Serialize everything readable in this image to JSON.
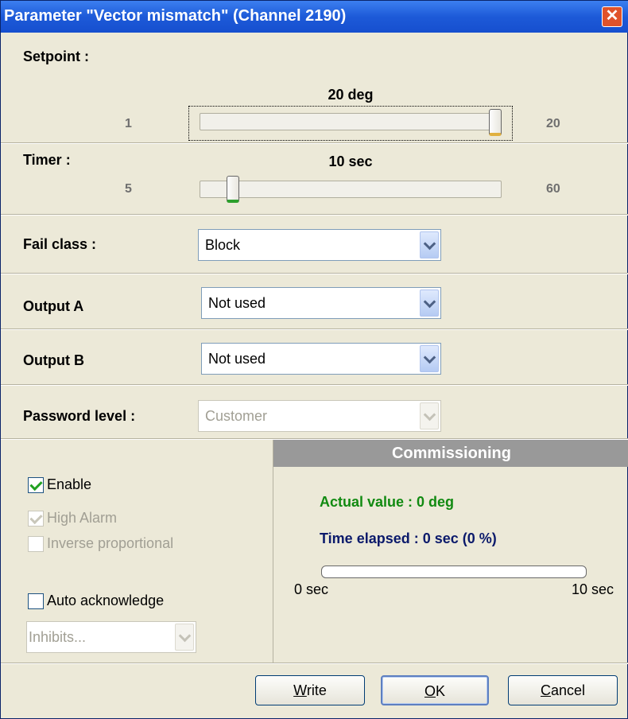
{
  "window": {
    "title": "Parameter \"Vector mismatch\" (Channel 2190)",
    "close_glyph": "✕"
  },
  "setpoint": {
    "label": "Setpoint :",
    "value_text": "20 deg",
    "min": "1",
    "max": "20",
    "value": 20
  },
  "timer": {
    "label": "Timer :",
    "value_text": "10 sec",
    "min": "5",
    "max": "60",
    "value": 10
  },
  "fail_class": {
    "label": "Fail class :",
    "value": "Block"
  },
  "output_a": {
    "label": "Output A",
    "value": "Not used"
  },
  "output_b": {
    "label": "Output B",
    "value": "Not used"
  },
  "password_level": {
    "label": "Password level :",
    "value": "Customer"
  },
  "options": {
    "enable": {
      "label": "Enable",
      "checked": true,
      "disabled": false
    },
    "high_alarm": {
      "label": "High Alarm",
      "checked": true,
      "disabled": true
    },
    "inverse_proportional": {
      "label": "Inverse proportional",
      "checked": false,
      "disabled": true
    },
    "auto_acknowledge": {
      "label": "Auto acknowledge",
      "checked": false,
      "disabled": false
    },
    "inhibits": {
      "value": "Inhibits..."
    }
  },
  "commissioning": {
    "header": "Commissioning",
    "actual_value": "Actual value : 0 deg",
    "time_elapsed": "Time elapsed : 0 sec (0 %)",
    "progress_fraction": 0,
    "progress_min_label": "0 sec",
    "progress_max_label": "10 sec"
  },
  "buttons": {
    "write": {
      "pre": "",
      "key": "W",
      "post": "rite"
    },
    "ok": {
      "pre": "",
      "key": "O",
      "post": "K"
    },
    "cancel": {
      "pre": "",
      "key": "C",
      "post": "ancel"
    }
  },
  "colors": {
    "title_bar": "#1d5ad8",
    "actual_value": "#118a11",
    "time_elapsed": "#0b1a6b",
    "commissioning_header": "#999999",
    "check": "#21a121"
  }
}
